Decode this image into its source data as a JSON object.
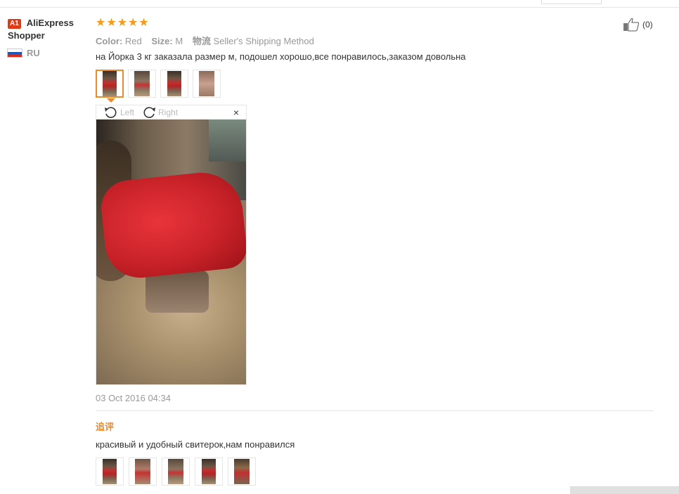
{
  "user": {
    "level_badge": "A1",
    "name": "AliExpress Shopper",
    "country": "RU"
  },
  "review": {
    "rating_stars": 5,
    "color_label": "Color:",
    "color_value": "Red",
    "size_label": "Size:",
    "size_value": "M",
    "shipping_label": "物流",
    "shipping_value": "Seller's Shipping Method",
    "text": "на Йорка 3 кг заказала размер м, подошел хорошо,все понравилось,заказом довольна",
    "helpful_count": "(0)",
    "photo_count": 4,
    "date": "03 Oct 2016 04:34"
  },
  "viewer": {
    "rotate_left": "Left",
    "rotate_right": "Right",
    "close": "×"
  },
  "followup": {
    "label": "追评",
    "text": "красивый и удобный свитерок,нам понравился",
    "photo_count": 5
  },
  "colors": {
    "star": "#f59a1b",
    "accent": "#e88b2d",
    "badge": "#e03a17"
  }
}
